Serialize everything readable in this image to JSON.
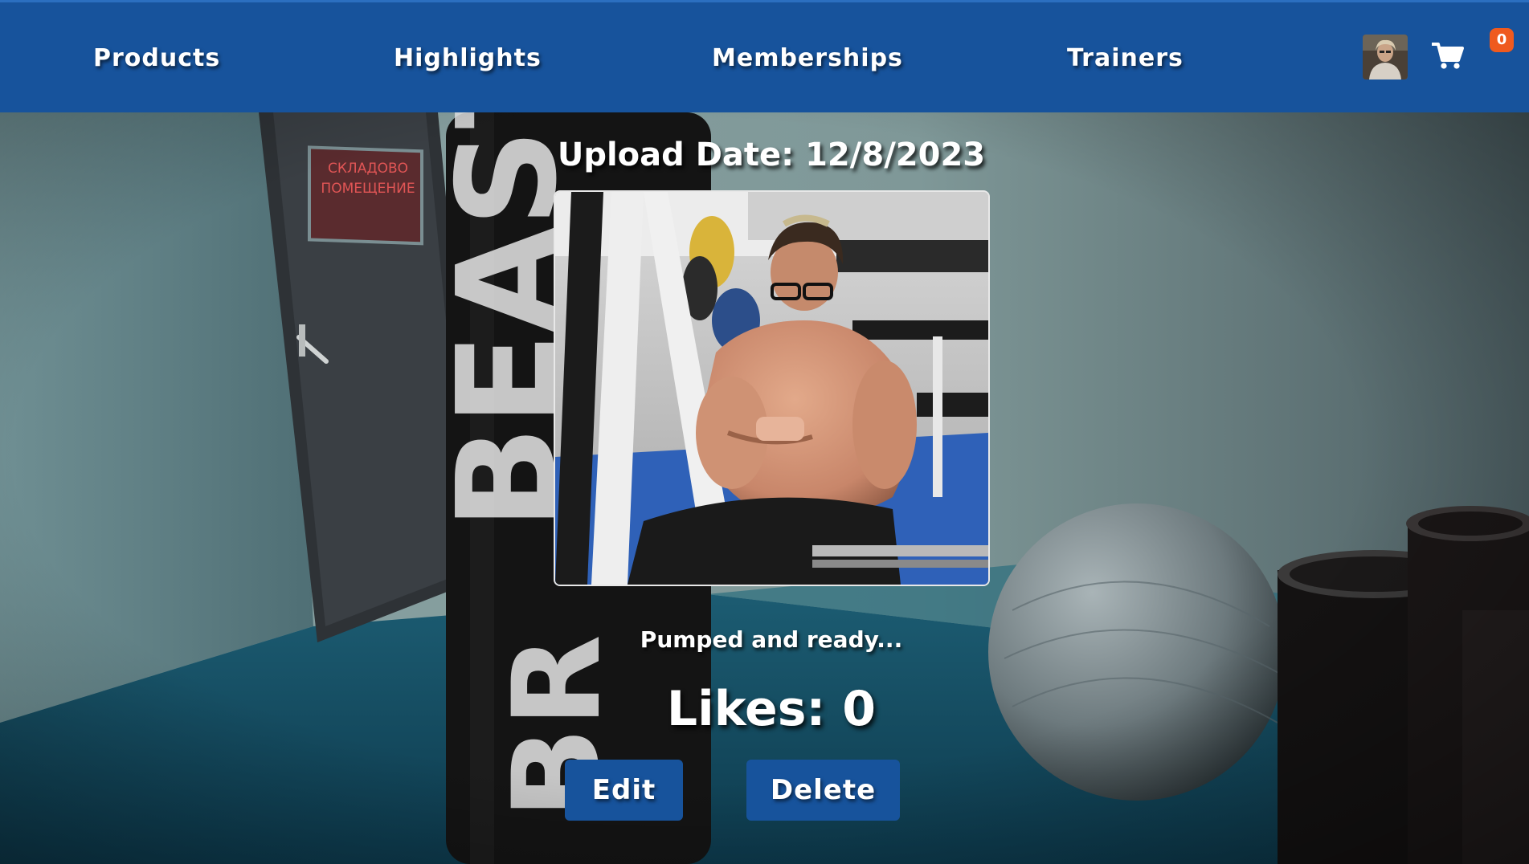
{
  "nav": {
    "products": "Products",
    "highlights": "Highlights",
    "memberships": "Memberships",
    "trainers": "Trainers"
  },
  "cart": {
    "count": "0",
    "icon": "cart-icon"
  },
  "highlight": {
    "upload_date": "Upload Date: 12/8/2023",
    "caption": "Pumped and ready...",
    "likes": "Likes: 0",
    "edit_label": "Edit",
    "delete_label": "Delete"
  },
  "colors": {
    "navbar": "#17539c",
    "button": "#17539c",
    "badge": "#ef5a1e",
    "text": "#ffffff"
  }
}
